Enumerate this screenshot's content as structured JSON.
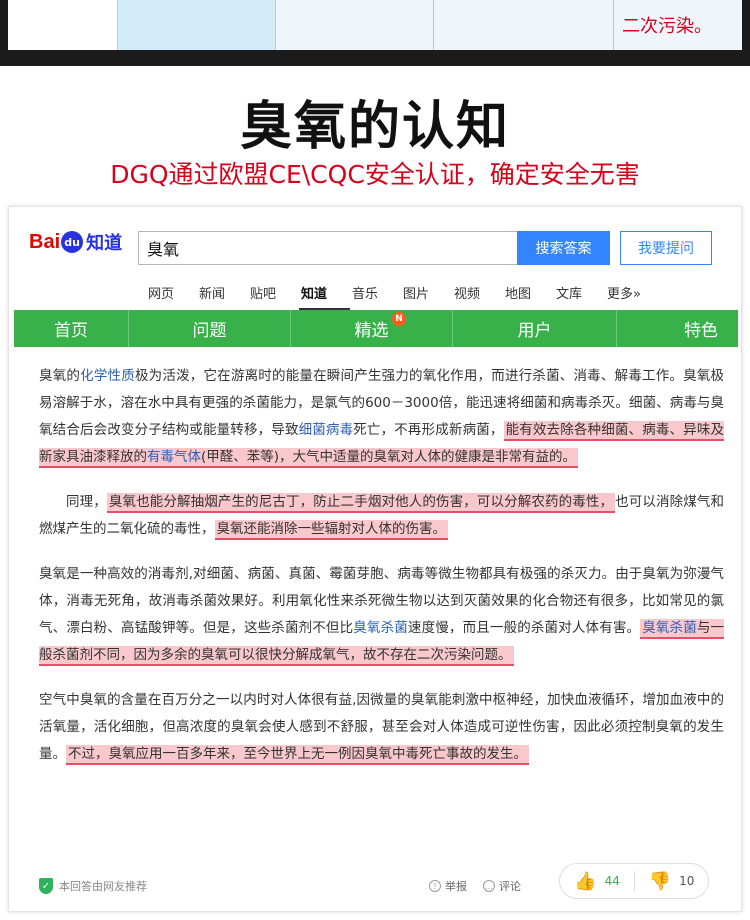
{
  "top_table": {
    "last_cell_text": "二次污染。"
  },
  "header": {
    "title": "臭氧的认知",
    "subtitle": "DGQ通过欧盟CE\\CQC安全认证，确定安全无害"
  },
  "baidu": {
    "logo": {
      "bai": "Bai",
      "paw": "du",
      "zhidao": "知道"
    },
    "search": {
      "value": "臭氧",
      "button": "搜索答案",
      "ask_button": "我要提问"
    },
    "nav": [
      "网页",
      "新闻",
      "贴吧",
      "知道",
      "音乐",
      "图片",
      "视频",
      "地图",
      "文库",
      "更多»"
    ],
    "nav_active_index": 3,
    "tabs": [
      "首页",
      "问题",
      "精选",
      "用户",
      "特色"
    ],
    "tab_badge": "N",
    "paragraphs": {
      "p1": {
        "a": "臭氧的",
        "link1": "化学性质",
        "b": "极为活泼，它在游离时的能量在瞬间产生强力的氧化作用，而进行杀菌、消毒、解毒工作。臭氧极易溶解于水，溶在水中具有更强的杀菌能力，是氯气的600－3000倍，能迅速将细菌和病毒杀灭。细菌、病毒与臭氧结合后会改变分子结构或能量转移，导致",
        "link2": "细菌病毒",
        "c": "死亡，不再形成新病菌，",
        "hl_a": "能有效去除各种细菌、病毒、异味及新家具油漆释放的",
        "hl_link": "有毒气体",
        "hl_b": "(甲醛、苯等)，大气中适量的臭氧对人体的健康是非常有益的。"
      },
      "p2": {
        "a": "同理，",
        "hl1": "臭氧也能分解抽烟产生的尼古丁，防止二手烟对他人的伤害，可以分解农药的毒性，",
        "b": "也可以消除煤气和燃煤产生的二氧化硫的毒性，",
        "hl2": "臭氧还能消除一些辐射对人体的伤害。"
      },
      "p3": {
        "a": "臭氧是一种高效的消毒剂,对细菌、病菌、真菌、霉菌芽胞、病毒等微生物都具有极强的杀灭力。由于臭氧为弥漫气体，消毒无死角，故消毒杀菌效果好。利用氧化性来杀死微生物以达到灭菌效果的化合物还有很多，比如常见的氯气、漂白粉、高锰酸钾等。但是，这些杀菌剂不但比",
        "link1": "臭氧杀菌",
        "b": "速度慢，而且一般的杀菌对人体有害。",
        "hl_link": "臭氧杀菌",
        "hl": "与一般杀菌剂不同，因为多余的臭氧可以很快分解成氧气，故不存在二次污染问题。"
      },
      "p4": {
        "a": "空气中臭氧的含量在百万分之一以内时对人体很有益,因微量的臭氧能刺激中枢神经，加快血液循环，增加血液中的活氧量，活化细胞，但高浓度的臭氧会使人感到不舒服，甚至会对人体造成可逆性伤害，因此必须控制臭氧的发生量。",
        "hl": "不过，臭氧应用一百多年来，至今世界上无一例因臭氧中毒死亡事故的发生。"
      }
    },
    "footer": {
      "recommend": "本回答由网友推荐",
      "report": "举报",
      "comment": "评论",
      "likes": "44",
      "dislikes": "10"
    }
  }
}
